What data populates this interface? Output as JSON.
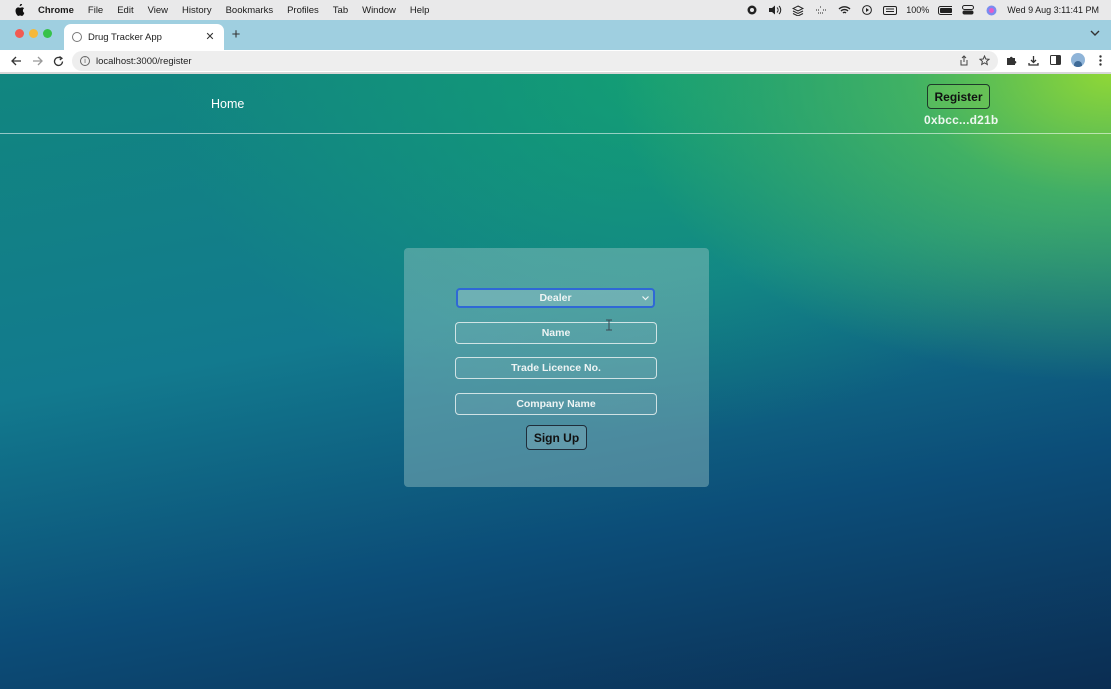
{
  "menubar": {
    "app_name": "Chrome",
    "items": [
      "File",
      "Edit",
      "View",
      "History",
      "Bookmarks",
      "Profiles",
      "Tab",
      "Window",
      "Help"
    ],
    "battery": "100%",
    "datetime": "Wed 9 Aug  3:11:41 PM"
  },
  "browser": {
    "tab_title": "Drug Tracker App",
    "url": "localhost:3000/register"
  },
  "navbar": {
    "home_label": "Home",
    "register_label": "Register",
    "account_address": "0xbcc...d21b"
  },
  "form": {
    "role_selected": "Dealer",
    "name_placeholder": "Name",
    "licence_placeholder": "Trade Licence No.",
    "company_placeholder": "Company Name",
    "submit_label": "Sign Up"
  }
}
